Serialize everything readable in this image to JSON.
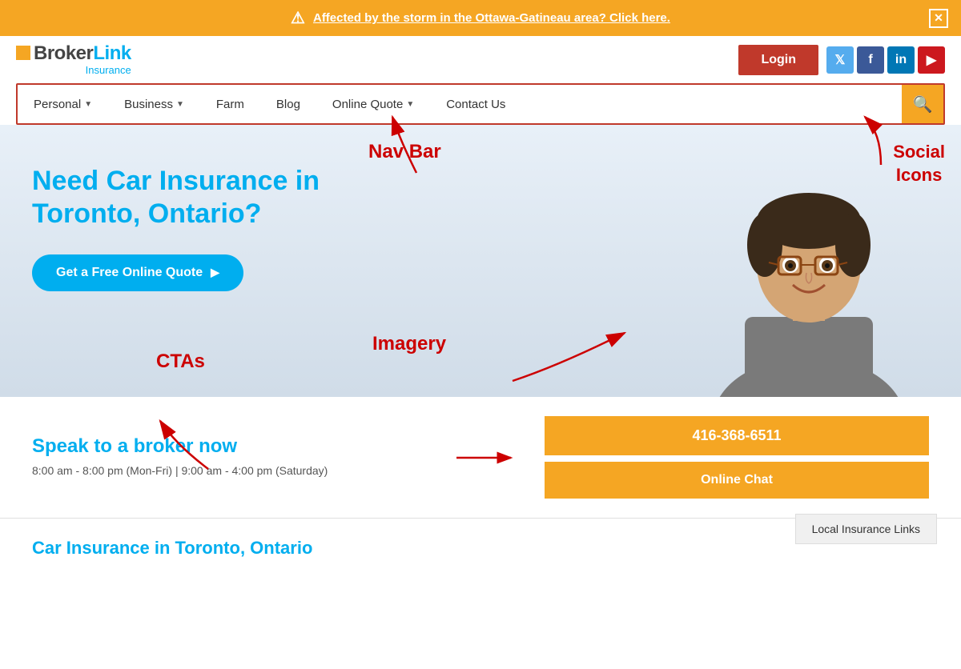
{
  "alert": {
    "text": "Affected by the storm in the Ottawa-Gatineau area? Click here.",
    "close_label": "✕"
  },
  "header": {
    "logo_broker": "BrokerLink",
    "logo_insurance": "Insurance",
    "login_label": "Login",
    "social": [
      {
        "name": "twitter",
        "symbol": "𝕏"
      },
      {
        "name": "facebook",
        "symbol": "f"
      },
      {
        "name": "linkedin",
        "symbol": "in"
      },
      {
        "name": "youtube",
        "symbol": "▶"
      }
    ]
  },
  "navbar": {
    "items": [
      {
        "label": "Personal",
        "has_dropdown": true
      },
      {
        "label": "Business",
        "has_dropdown": true
      },
      {
        "label": "Farm",
        "has_dropdown": false
      },
      {
        "label": "Blog",
        "has_dropdown": false
      },
      {
        "label": "Online Quote",
        "has_dropdown": true
      },
      {
        "label": "Contact Us",
        "has_dropdown": false
      }
    ],
    "search_placeholder": "Search"
  },
  "hero": {
    "title": "Need Car Insurance in Toronto, Ontario?",
    "cta_label": "Get a Free Online Quote"
  },
  "annotations": {
    "nav_bar": "Nav Bar",
    "social_icons": "Social\nIcons",
    "imagery": "Imagery",
    "ctas": "CTAs"
  },
  "contact": {
    "title": "Speak to a broker now",
    "hours": "8:00 am - 8:00 pm (Mon-Fri) | 9:00 am - 4:00 pm\n(Saturday)",
    "phone": "416-368-6511",
    "chat_label": "Online Chat"
  },
  "bottom": {
    "title": "Car Insurance in Toronto, Ontario",
    "local_links_label": "Local Insurance Links"
  }
}
